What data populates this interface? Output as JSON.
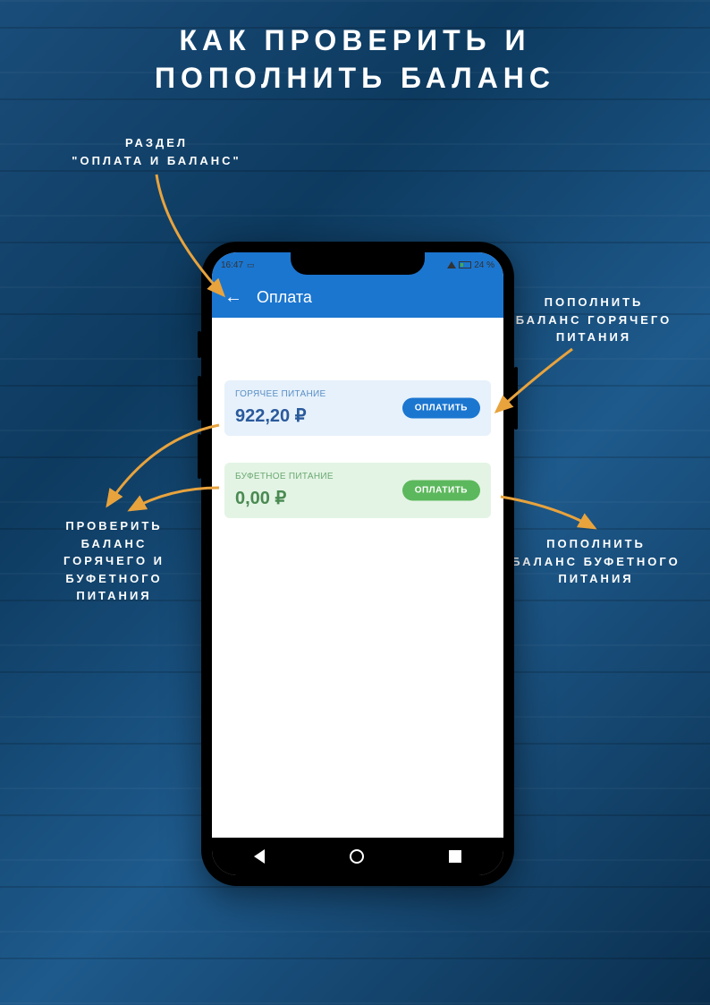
{
  "page_title_l1": "КАК ПРОВЕРИТЬ И",
  "page_title_l2": "ПОПОЛНИТЬ БАЛАНС",
  "callouts": {
    "section": "РАЗДЕЛ\n\"ОПЛАТА И БАЛАНС\"",
    "section_l1": "РАЗДЕЛ",
    "section_l2": "\"ОПЛАТА И БАЛАНС\"",
    "topup_hot_l1": "ПОПОЛНИТЬ",
    "topup_hot_l2": "БАЛАНС ГОРЯЧЕГО",
    "topup_hot_l3": "ПИТАНИЯ",
    "topup_buf_l1": "ПОПОЛНИТЬ",
    "topup_buf_l2": "БАЛАНС БУФЕТНОГО",
    "topup_buf_l3": "ПИТАНИЯ",
    "check_l1": "ПРОВЕРИТЬ",
    "check_l2": "БАЛАНС",
    "check_l3": "ГОРЯЧЕГО И",
    "check_l4": "БУФЕТНОГО",
    "check_l5": "ПИТАНИЯ"
  },
  "statusbar": {
    "time": "16:47",
    "battery": "24 %"
  },
  "appbar": {
    "title": "Оплата"
  },
  "cards": {
    "hot": {
      "label": "ГОРЯЧЕЕ ПИТАНИЕ",
      "amount": "922,20 ₽",
      "button": "ОПЛАТИТЬ"
    },
    "buffet": {
      "label": "БУФЕТНОЕ ПИТАНИЕ",
      "amount": "0,00 ₽",
      "button": "ОПЛАТИТЬ"
    }
  }
}
